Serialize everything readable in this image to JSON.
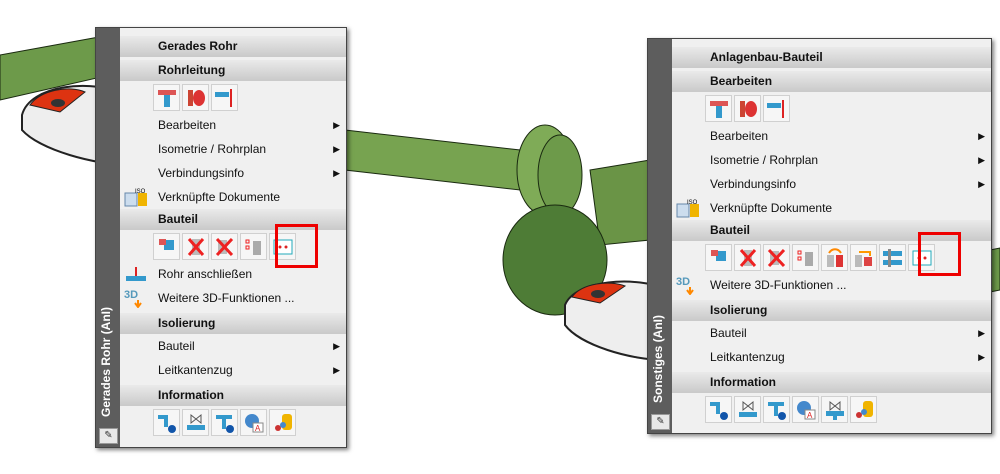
{
  "left_menu": {
    "side_title": "Gerades Rohr (AnI)",
    "title": "Gerades Rohr",
    "sections": [
      {
        "header": "Rohrleitung",
        "items": [
          "Bearbeiten",
          "Isometrie / Rohrplan",
          "Verbindungsinfo",
          "Verknüpfte Dokumente"
        ]
      },
      {
        "header": "Bauteil",
        "items": [
          "Rohr anschließen",
          "Weitere 3D-Funktionen ..."
        ]
      },
      {
        "header": "Isolierung",
        "items": [
          "Bauteil",
          "Leitkantenzug"
        ]
      },
      {
        "header": "Information",
        "items": []
      }
    ]
  },
  "right_menu": {
    "side_title": "Sonstiges (AnI)",
    "title": "Anlagenbau-Bauteil",
    "sections": [
      {
        "header": "Bearbeiten",
        "items": [
          "Bearbeiten",
          "Isometrie / Rohrplan",
          "Verbindungsinfo",
          "Verknüpfte Dokumente"
        ]
      },
      {
        "header": "Bauteil",
        "items": [
          "Weitere 3D-Funktionen ..."
        ]
      },
      {
        "header": "Isolierung",
        "items": [
          "Bauteil",
          "Leitkantenzug"
        ]
      },
      {
        "header": "Information",
        "items": []
      }
    ]
  },
  "icons": {
    "iso_label": "ISO",
    "threed_label": "3D",
    "pen": "✎",
    "submenu_arrow": "▶"
  },
  "colors": {
    "highlight": "#e00000",
    "pipe": "#6b8f4a",
    "header": "#d0d0d0",
    "strip": "#5d5d5d"
  }
}
